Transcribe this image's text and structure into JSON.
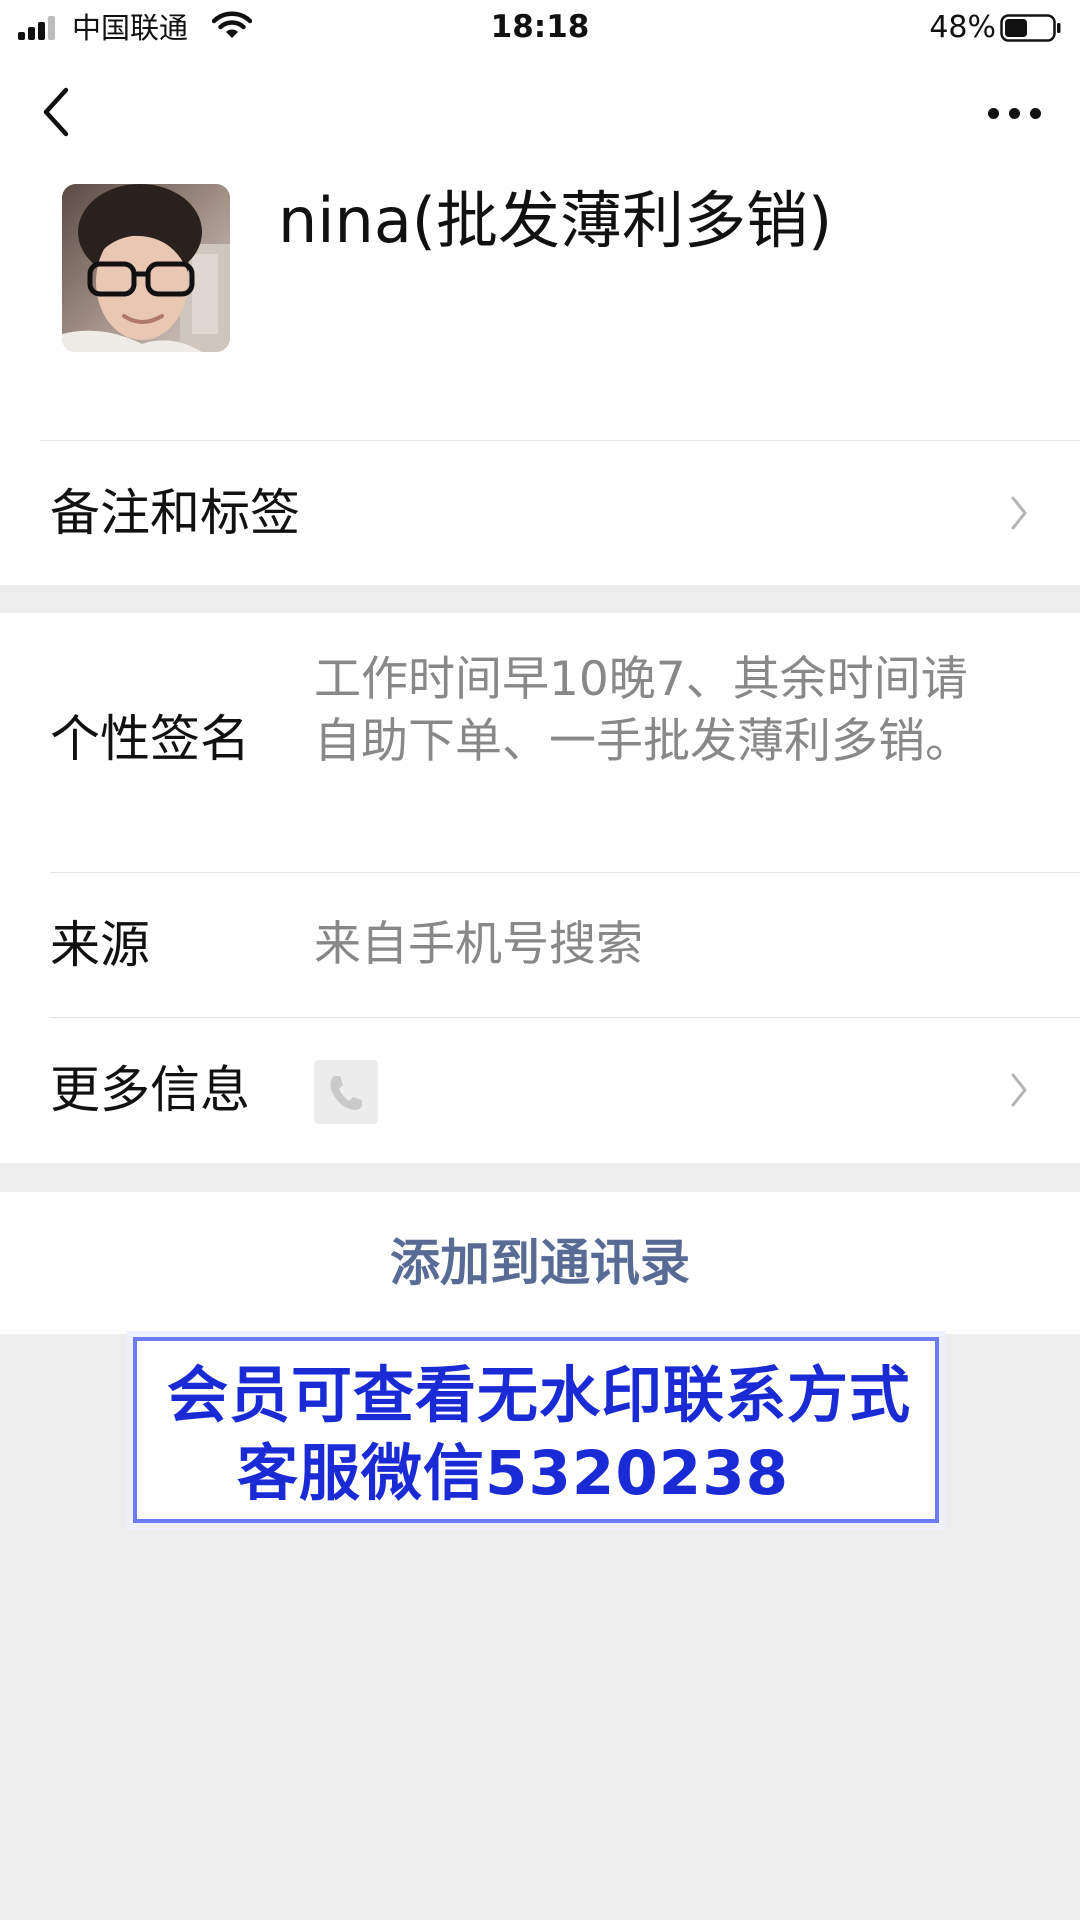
{
  "status_bar": {
    "carrier": "中国联通",
    "time": "18:18",
    "battery": "48%"
  },
  "profile": {
    "nickname": "nina(批发薄利多销)"
  },
  "rows": {
    "remark_label": "备注和标签",
    "signature_label": "个性签名",
    "signature_value": "工作时间早10晚7、其余时间请自助下单、一手批发薄利多销。",
    "source_label": "来源",
    "source_value": "来自手机号搜索",
    "more_label": "更多信息"
  },
  "actions": {
    "add_contact": "添加到通讯录"
  },
  "banner": {
    "line1": "会员可查看无水印联系方式",
    "line2": "客服微信5320238"
  },
  "colors": {
    "link": "#576b95",
    "banner_text": "#1a2bd6",
    "banner_border": "#6d7cf0"
  }
}
